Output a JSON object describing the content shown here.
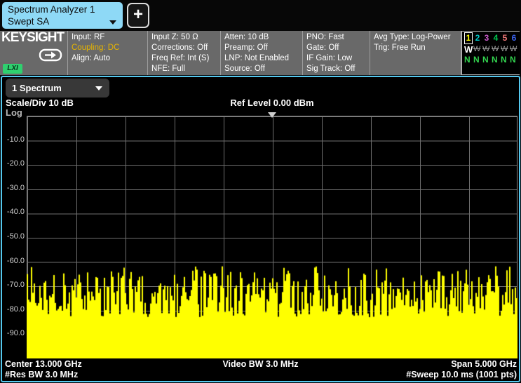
{
  "tabs": {
    "active": {
      "line1": "Spectrum Analyzer 1",
      "line2": "Swept SA"
    },
    "add_button": "+"
  },
  "brand": {
    "logo": "KEYSIGHT",
    "badge": "LXI"
  },
  "status": {
    "col_input": [
      "Input: RF",
      "Coupling: DC",
      "Align: Auto"
    ],
    "col_z": [
      "Input Z: 50 Ω",
      "Corrections: Off",
      "Freq Ref: Int (S)",
      "NFE: Full"
    ],
    "col_atten": [
      "Atten: 10 dB",
      "Preamp: Off",
      "LNP: Not Enabled",
      "Source: Off"
    ],
    "col_pno": [
      "PNO: Fast",
      "Gate: Off",
      "IF Gain: Low",
      "Sig Track: Off"
    ],
    "col_avg": [
      "Avg Type: Log-Power",
      "Trig: Free Run"
    ],
    "highlight_color": "#e6b400"
  },
  "trace_legend": {
    "numbers": [
      "1",
      "2",
      "3",
      "4",
      "5",
      "6"
    ],
    "number_colors": [
      "#ffff00",
      "#00c8c8",
      "#c85ac8",
      "#00c850",
      "#f07878",
      "#3c64f0"
    ],
    "active_index": 0,
    "type_row": [
      "W",
      "W",
      "W",
      "W",
      "W",
      "W"
    ],
    "detector_row": [
      "N",
      "N",
      "N",
      "N",
      "N",
      "N"
    ],
    "type_active_color": "#ffffff",
    "type_dim_color": "#9a9a9a",
    "detector_color": "#32d24e"
  },
  "measurement_selector": {
    "label": "1 Spectrum"
  },
  "graph": {
    "scale_div": "Scale/Div 10 dB",
    "ref_level": "Ref Level 0.00 dBm",
    "amplitude_mode": "Log",
    "y_ticks": [
      "-10.0",
      "-20.0",
      "-30.0",
      "-40.0",
      "-50.0",
      "-60.0",
      "-70.0",
      "-80.0",
      "-90.0"
    ]
  },
  "footer": {
    "center_freq": "Center 13.000 GHz",
    "video_bw": "Video BW 3.0 MHz",
    "span": "Span 5.000 GHz",
    "res_bw": "#Res BW 3.0 MHz",
    "sweep": "#Sweep 10.0 ms (1001 pts)"
  },
  "colors": {
    "frame_accent": "#55c8ee",
    "tab_bg": "#8ed9f6",
    "panel_bg": "#696969",
    "trace_yellow": "#ffff00",
    "grid_line": "#6f6f6f"
  },
  "chart_data": {
    "type": "area",
    "description": "Swept SA noise-floor trace (clear/write, yellow fill)",
    "x": {
      "center_GHz": 13.0,
      "span_GHz": 5.0,
      "points": 1001
    },
    "y": {
      "ref_level_dBm": 0.0,
      "scale_div_dB": 10,
      "bottom_dBm": -100,
      "tick_dBm": [
        -10,
        -20,
        -30,
        -40,
        -50,
        -60,
        -70,
        -80,
        -90
      ]
    },
    "grid": {
      "x_divisions": 10,
      "y_divisions": 10
    },
    "trace": {
      "color": "#ffff00",
      "style": "filled-noise",
      "noise_top_typical_dBm": [
        -64,
        -83
      ],
      "noise_peaks_dBm": -62,
      "solid_below_dBm": -83,
      "seed": 987654321
    }
  }
}
